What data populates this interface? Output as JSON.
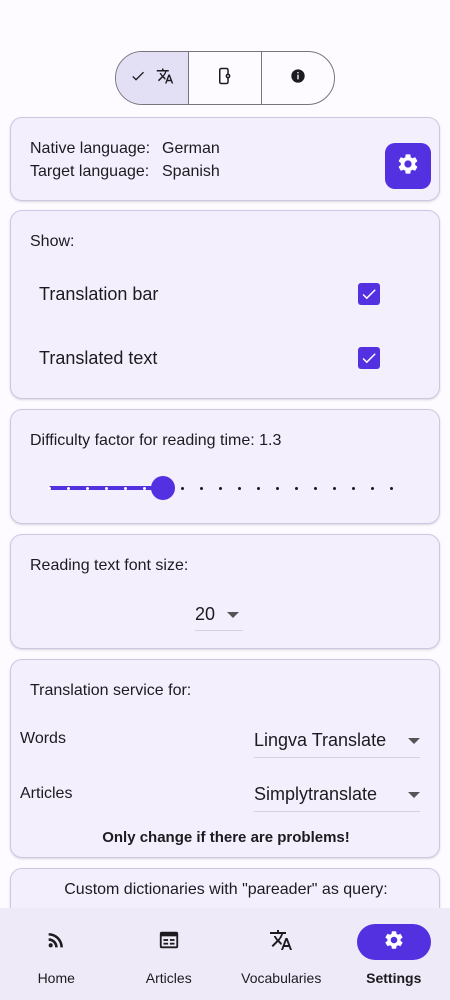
{
  "segments": [
    {
      "name": "translate",
      "selected": true
    },
    {
      "name": "device",
      "selected": false
    },
    {
      "name": "info",
      "selected": false
    }
  ],
  "languages": {
    "native_label": "Native language:",
    "native_value": "German",
    "target_label": "Target language:",
    "target_value": "Spanish"
  },
  "show": {
    "heading": "Show:",
    "translation_bar": "Translation bar",
    "translation_bar_checked": true,
    "translated_text": "Translated text",
    "translated_text_checked": true
  },
  "difficulty": {
    "label": "Difficulty factor for reading time: 1.3",
    "value": 1.3
  },
  "font_size": {
    "label": "Reading text font size:",
    "value": "20"
  },
  "translation_service": {
    "heading": "Translation service for:",
    "words_label": "Words",
    "words_value": "Lingva Translate",
    "articles_label": "Articles",
    "articles_value": "Simplytranslate",
    "warning": "Only change if there are problems!"
  },
  "custom_dict": {
    "heading": "Custom dictionaries with \"pareader\" as query:"
  },
  "nav": [
    {
      "label": "Home",
      "icon": "rss-icon",
      "active": false
    },
    {
      "label": "Articles",
      "icon": "articles-icon",
      "active": false
    },
    {
      "label": "Vocabularies",
      "icon": "translate-icon",
      "active": false
    },
    {
      "label": "Settings",
      "icon": "gear-icon",
      "active": true
    }
  ],
  "colors": {
    "accent": "#5331e0",
    "card": "#f4effd"
  }
}
